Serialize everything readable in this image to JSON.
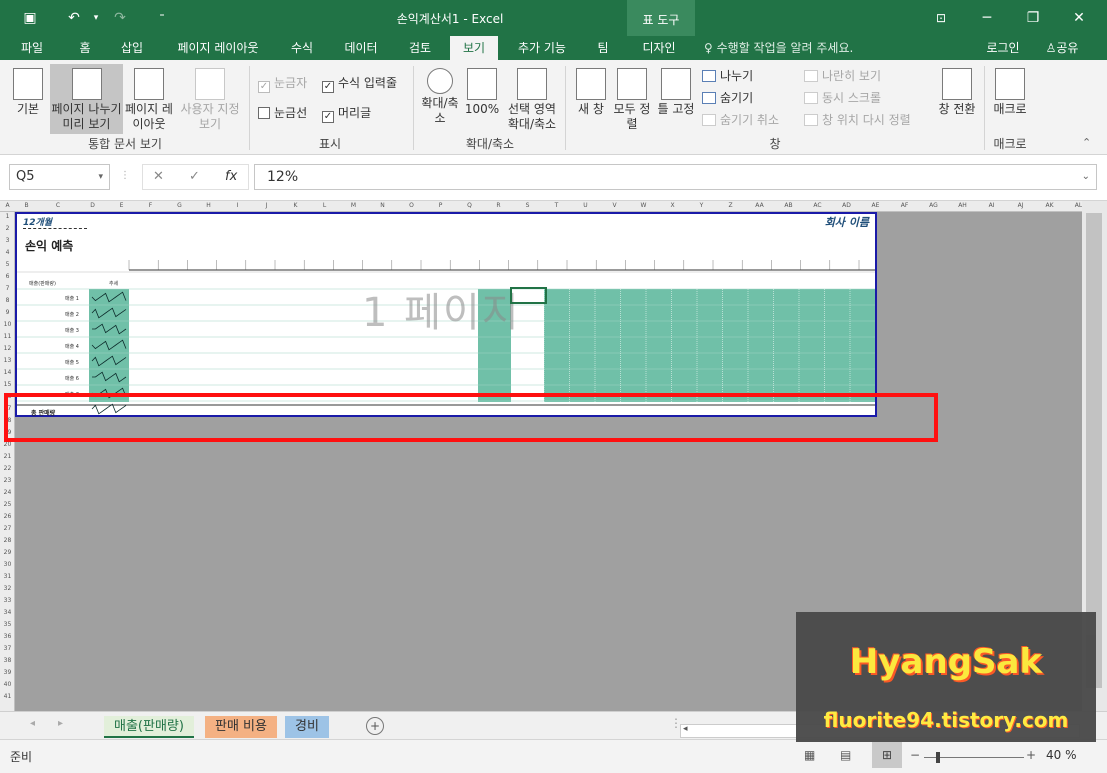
{
  "titlebar": {
    "title": "손익계산서1 - Excel",
    "tool_tab": "표 도구",
    "login": "로그인",
    "share": "공유"
  },
  "menu": {
    "file": "파일",
    "tabs": [
      "홈",
      "삽입",
      "페이지 레이아웃",
      "수식",
      "데이터",
      "검토",
      "보기",
      "추가 기능",
      "팀",
      "디자인"
    ],
    "active": "보기",
    "tell_me": "수행할 작업을 알려 주세요."
  },
  "ribbon": {
    "workbook_views": {
      "normal": "기본",
      "page_break": "페이지 나누기 미리 보기",
      "page_layout": "페이지 레이아웃",
      "custom": "사용자 지정 보기",
      "group": "통합 문서 보기"
    },
    "show": {
      "ruler": "눈금자",
      "formula_bar": "수식 입력줄",
      "gridlines": "눈금선",
      "headings": "머리글",
      "group": "표시"
    },
    "zoom": {
      "zoom": "확대/축소",
      "hundred": "100%",
      "selection": "선택 영역 확대/축소",
      "group": "확대/축소"
    },
    "window": {
      "new_window": "새 창",
      "arrange": "모두 정렬",
      "freeze": "틀 고정",
      "split": "나누기",
      "hide": "숨기기",
      "unhide": "숨기기 취소",
      "side_by_side": "나란히 보기",
      "sync_scroll": "동시 스크롤",
      "reset_pos": "창 위치 다시 정렬",
      "switch": "창 전환",
      "group": "창"
    },
    "macros": {
      "macros": "매크로",
      "group": "매크로"
    }
  },
  "formula": {
    "namebox": "Q5",
    "fx": "fx",
    "value": "12%"
  },
  "sheet": {
    "title_left": "12개월",
    "company": "회사 이름",
    "report_title": "손익 예측",
    "page_watermark": "1 페이지",
    "row_label_header": "매출(판매량)",
    "trend_header": "추세",
    "total_label": "총 판매량",
    "rows": [
      "매출 1",
      "매출 2",
      "매출 3",
      "매출 4",
      "매출 5",
      "매출 6",
      "매출 7"
    ],
    "col_headers": [
      "A",
      "B",
      "C",
      "D",
      "E",
      "F",
      "G",
      "H",
      "I",
      "J",
      "K",
      "L",
      "M",
      "N",
      "O",
      "P",
      "Q",
      "R",
      "S",
      "T",
      "U",
      "V",
      "W",
      "X",
      "Y",
      "Z",
      "AA",
      "AB",
      "AC",
      "AD",
      "AE",
      "AF",
      "AG",
      "AH",
      "AI",
      "AJ",
      "AK",
      "AL"
    ],
    "row_numbers": [
      "1",
      "2",
      "3",
      "4",
      "5",
      "6",
      "7",
      "8",
      "9",
      "10",
      "11",
      "12",
      "13",
      "14",
      "15",
      "16",
      "17",
      "18",
      "19",
      "20",
      "21",
      "22",
      "23",
      "24",
      "25",
      "26",
      "27",
      "28",
      "29",
      "30",
      "31",
      "32",
      "33",
      "34",
      "35",
      "36",
      "37",
      "38",
      "39",
      "40",
      "41"
    ]
  },
  "tabs": {
    "sheets": [
      "매출(판매량)",
      "판매 비용",
      "경비"
    ],
    "colors": [
      "#e2efda",
      "#f4b183",
      "#9dc3e6"
    ]
  },
  "status": {
    "ready": "준비",
    "zoom": "40 %"
  },
  "watermark": {
    "line1": "HyangSak",
    "line2": "fluorite94.tistory.com"
  }
}
